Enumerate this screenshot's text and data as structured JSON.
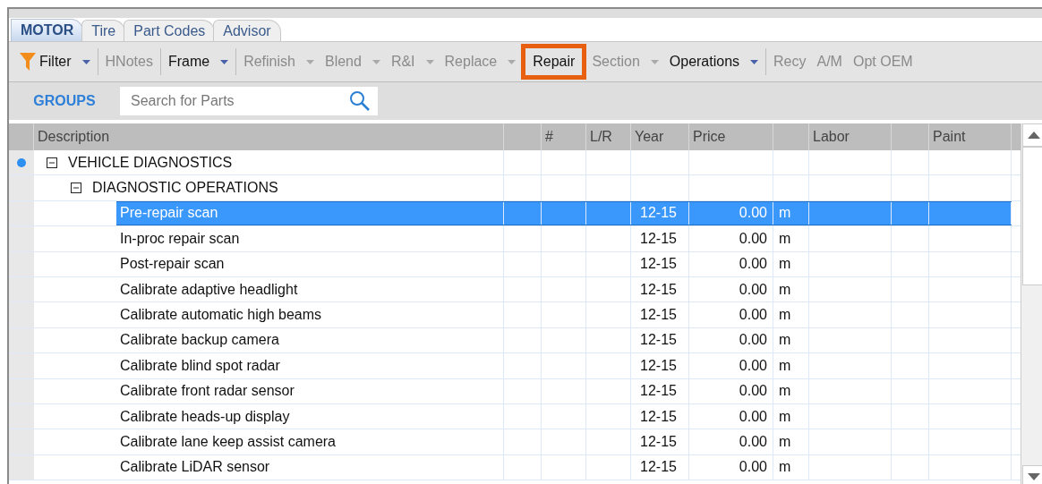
{
  "tabs": [
    {
      "label": "MOTOR",
      "selected": true
    },
    {
      "label": "Tire",
      "selected": false
    },
    {
      "label": "Part Codes",
      "selected": false
    },
    {
      "label": "Advisor",
      "selected": false
    }
  ],
  "toolbar": [
    {
      "label": "Filter",
      "disabled": false,
      "dropdown": true,
      "highlighted": false,
      "divider_after": true
    },
    {
      "label": "HNotes",
      "disabled": true,
      "dropdown": false,
      "highlighted": false,
      "divider_after": true
    },
    {
      "label": "Frame",
      "disabled": false,
      "dropdown": true,
      "highlighted": false,
      "divider_after": true
    },
    {
      "label": "Refinish",
      "disabled": true,
      "dropdown": true,
      "highlighted": false,
      "divider_after": false
    },
    {
      "label": "Blend",
      "disabled": true,
      "dropdown": true,
      "highlighted": false,
      "divider_after": false
    },
    {
      "label": "R&I",
      "disabled": true,
      "dropdown": true,
      "highlighted": false,
      "divider_after": false
    },
    {
      "label": "Replace",
      "disabled": true,
      "dropdown": true,
      "highlighted": false,
      "divider_after": false
    },
    {
      "label": "Repair",
      "disabled": false,
      "dropdown": false,
      "highlighted": true,
      "divider_after": false
    },
    {
      "label": "Section",
      "disabled": true,
      "dropdown": true,
      "highlighted": false,
      "divider_after": false
    },
    {
      "label": "Operations",
      "disabled": false,
      "dropdown": true,
      "highlighted": false,
      "divider_after": true
    },
    {
      "label": "Recy",
      "disabled": true,
      "dropdown": false,
      "highlighted": false,
      "divider_after": false
    },
    {
      "label": "A/M",
      "disabled": true,
      "dropdown": false,
      "highlighted": false,
      "divider_after": false
    },
    {
      "label": "Opt OEM",
      "disabled": true,
      "dropdown": false,
      "highlighted": false,
      "divider_after": false
    }
  ],
  "groups_label": "GROUPS",
  "search": {
    "placeholder": "Search for Parts"
  },
  "table": {
    "columns": [
      "Description",
      "",
      "#",
      "L/R",
      "Year",
      "Price",
      "",
      "Labor",
      "",
      "Paint"
    ],
    "rows": [
      {
        "description": "VEHICLE DIAGNOSTICS",
        "expanded": true,
        "marked": true,
        "children": [
          {
            "description": "DIAGNOSTIC OPERATIONS",
            "expanded": true,
            "marked": false,
            "children": [
              {
                "description": "Pre-repair scan",
                "year": "12-15",
                "price": "0.00",
                "unit": "m",
                "selected": true
              },
              {
                "description": "In-proc repair scan",
                "year": "12-15",
                "price": "0.00",
                "unit": "m",
                "selected": false
              },
              {
                "description": "Post-repair scan",
                "year": "12-15",
                "price": "0.00",
                "unit": "m",
                "selected": false
              },
              {
                "description": "Calibrate adaptive headlight",
                "year": "12-15",
                "price": "0.00",
                "unit": "m",
                "selected": false
              },
              {
                "description": "Calibrate automatic high beams",
                "year": "12-15",
                "price": "0.00",
                "unit": "m",
                "selected": false
              },
              {
                "description": "Calibrate backup camera",
                "year": "12-15",
                "price": "0.00",
                "unit": "m",
                "selected": false
              },
              {
                "description": "Calibrate blind spot radar",
                "year": "12-15",
                "price": "0.00",
                "unit": "m",
                "selected": false
              },
              {
                "description": "Calibrate front radar sensor",
                "year": "12-15",
                "price": "0.00",
                "unit": "m",
                "selected": false
              },
              {
                "description": "Calibrate heads-up display",
                "year": "12-15",
                "price": "0.00",
                "unit": "m",
                "selected": false
              },
              {
                "description": "Calibrate lane keep assist camera",
                "year": "12-15",
                "price": "0.00",
                "unit": "m",
                "selected": false
              },
              {
                "description": "Calibrate LiDAR sensor",
                "year": "12-15",
                "price": "0.00",
                "unit": "m",
                "selected": false
              }
            ]
          }
        ]
      }
    ]
  }
}
